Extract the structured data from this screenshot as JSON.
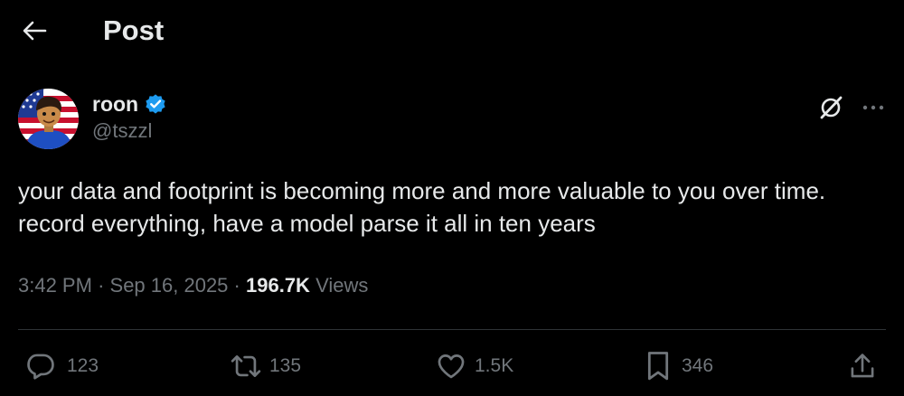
{
  "header": {
    "title": "Post",
    "back_icon": "arrow-left-icon"
  },
  "author": {
    "display_name": "roon",
    "handle": "@tszzl",
    "verified": true,
    "verified_color": "#1d9bf0"
  },
  "tweet": {
    "text": "your data and footprint is becoming more and more valuable to you over time. record everything, have a model parse it all in ten years"
  },
  "meta": {
    "time": "3:42 PM",
    "separator": "·",
    "date": "Sep 16, 2025",
    "views_count": "196.7K",
    "views_label": "Views"
  },
  "actions": {
    "replies": "123",
    "reposts": "135",
    "likes": "1.5K",
    "bookmarks": "346"
  },
  "icons": {
    "grok": "grok-icon",
    "more": "more-icon",
    "reply": "reply-icon",
    "repost": "repost-icon",
    "like": "heart-icon",
    "bookmark": "bookmark-icon",
    "share": "share-icon"
  },
  "colors": {
    "background": "#000000",
    "text_primary": "#e7e9ea",
    "text_secondary": "#71767b",
    "divider": "#2f3336",
    "accent": "#1d9bf0"
  }
}
